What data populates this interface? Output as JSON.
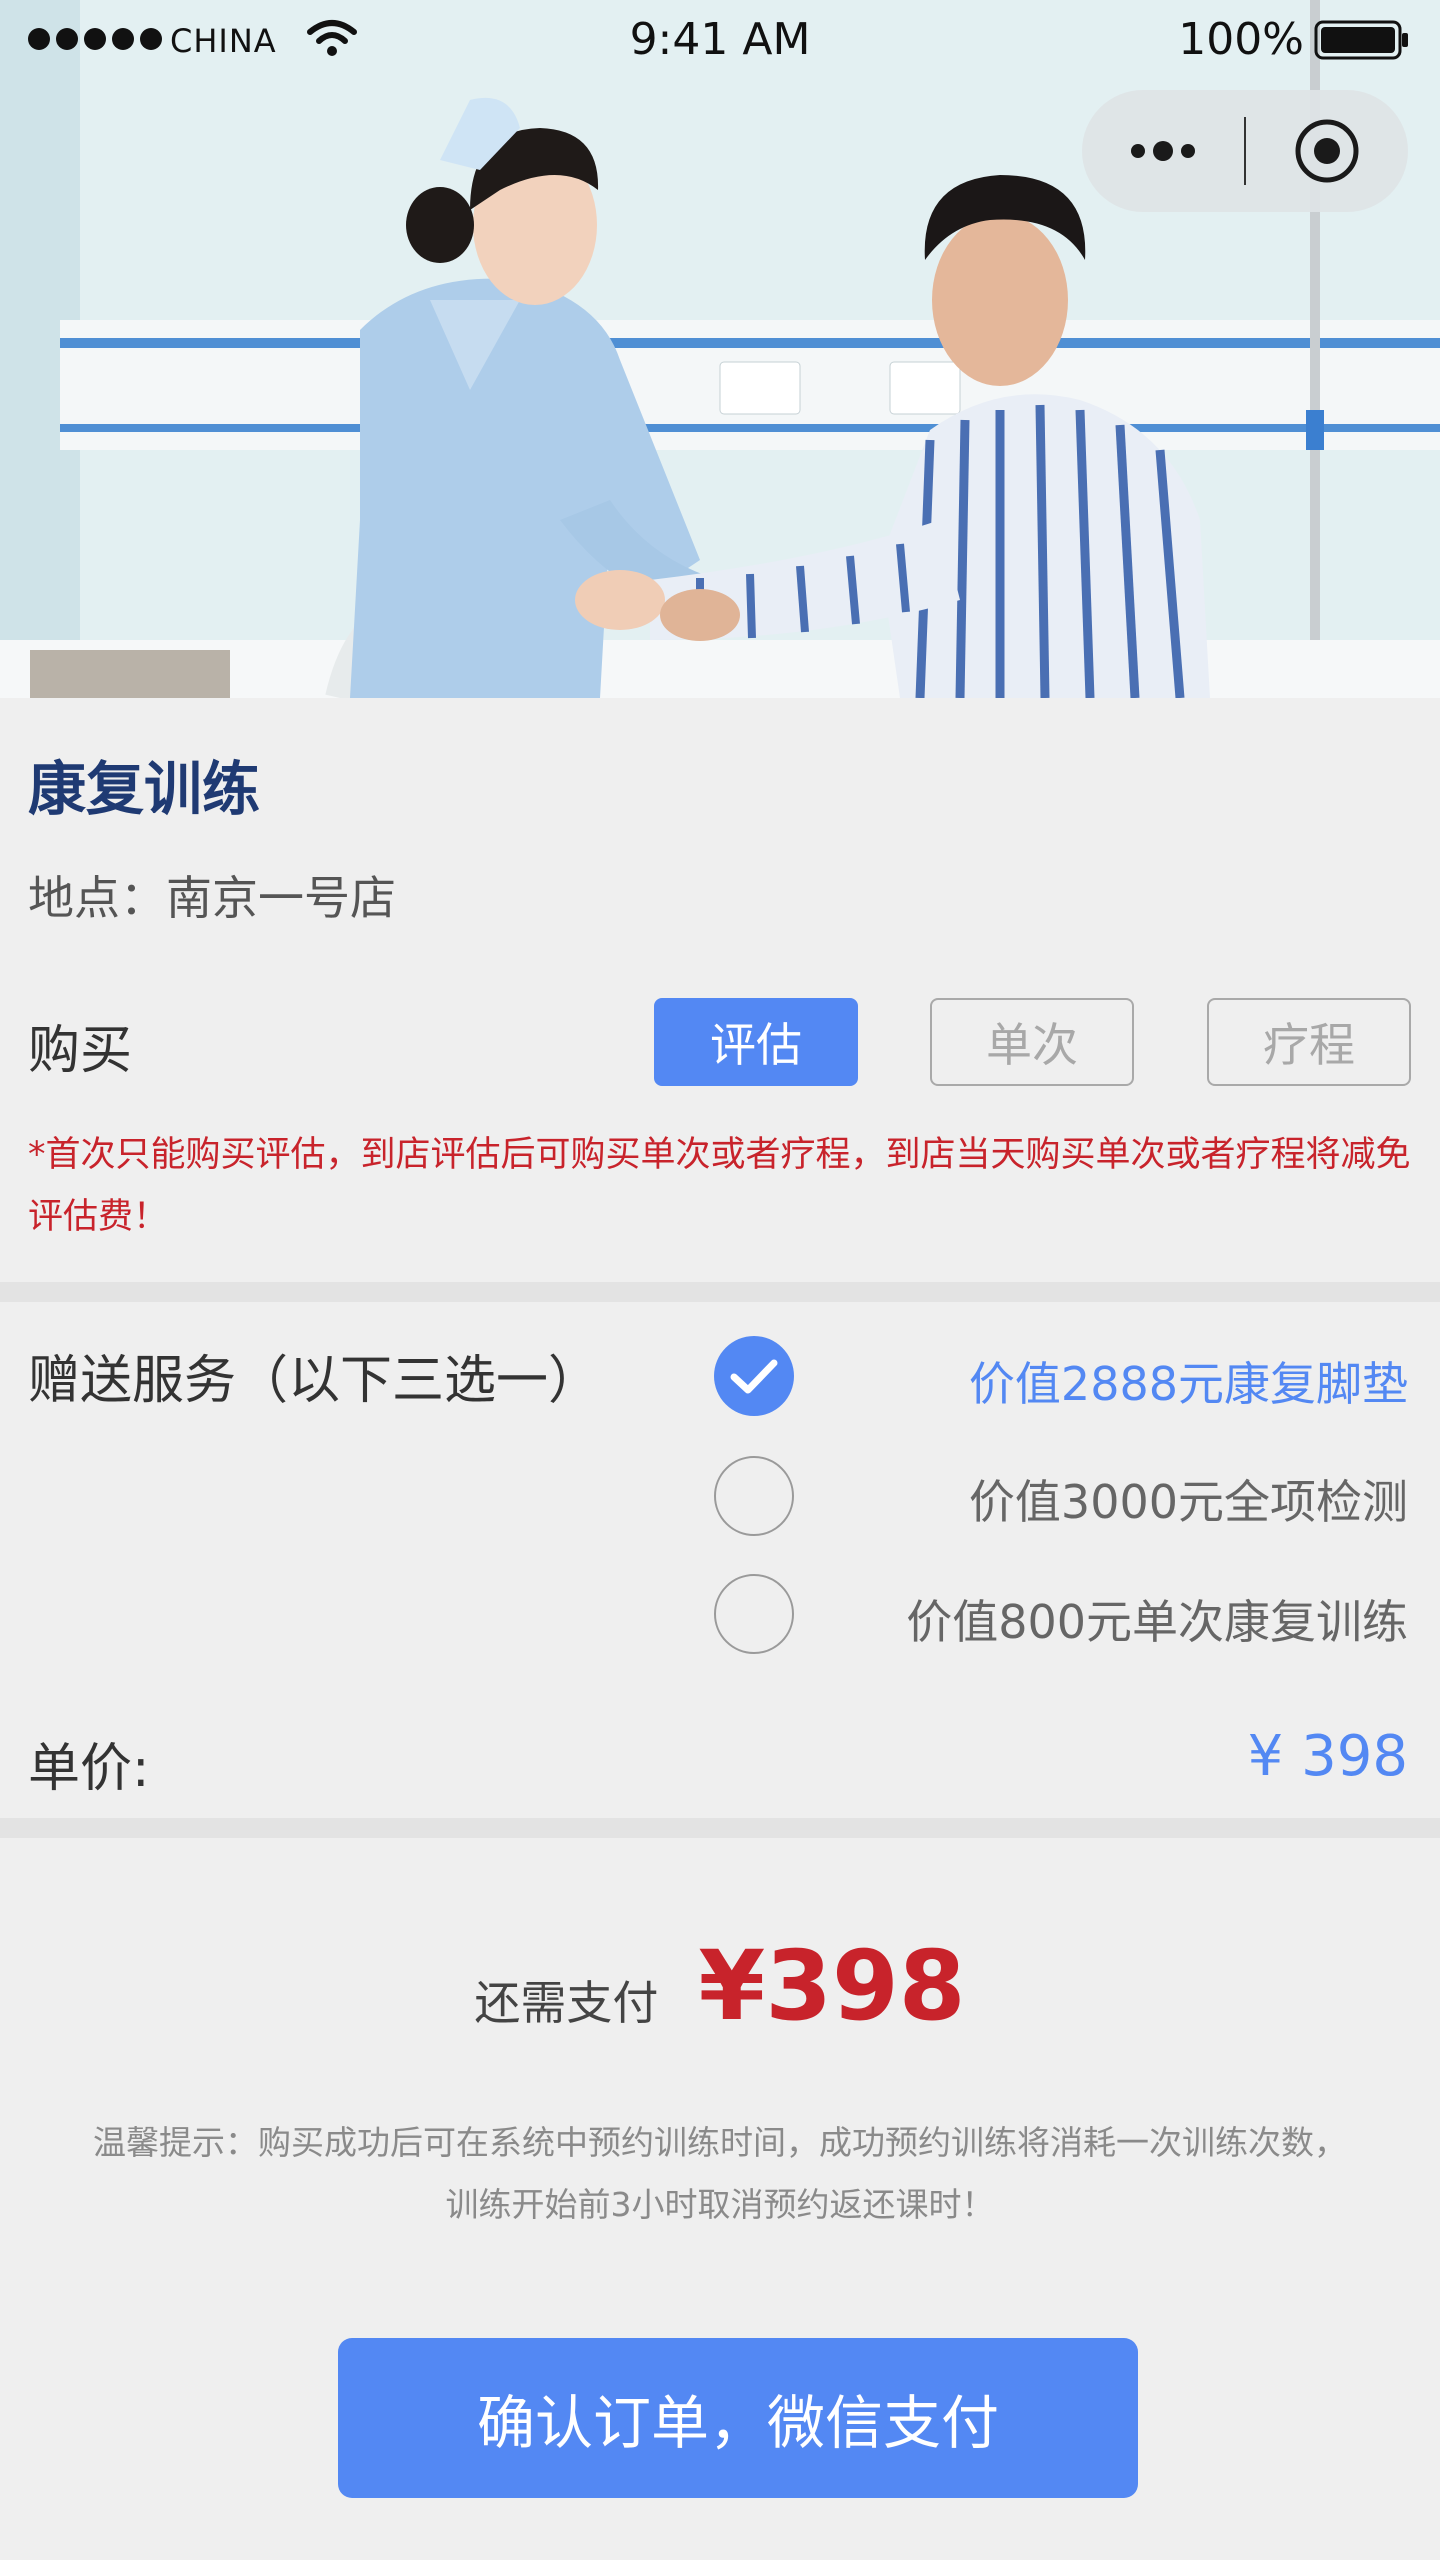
{
  "status_bar": {
    "carrier": "CHINA",
    "time": "9:41 AM",
    "battery": "100%"
  },
  "hero": {
    "image": "nurse-assisting-patient-photo"
  },
  "capsule": {
    "more_icon": "more-dots-icon",
    "close_icon": "target-circle-icon"
  },
  "product": {
    "title": "康复训练",
    "location": "地点：南京一号店"
  },
  "purchase": {
    "label": "购买",
    "options": [
      {
        "label": "评估",
        "selected": true
      },
      {
        "label": "单次",
        "selected": false
      },
      {
        "label": "疗程",
        "selected": false
      }
    ],
    "notice": "*首次只能购买评估，到店评估后可购买单次或者疗程，到店当天购买单次或者疗程将减免评估费！"
  },
  "gift": {
    "label": "赠送服务（以下三选一）",
    "options": [
      {
        "label": "价值2888元康复脚垫",
        "selected": true
      },
      {
        "label": "价值3000元全项检测",
        "selected": false
      },
      {
        "label": "价值800元单次康复训练",
        "selected": false
      }
    ]
  },
  "price": {
    "label": "单价:",
    "value": "¥ 398"
  },
  "payment": {
    "label": "还需支付",
    "amount": "¥398",
    "tip_line1": "温馨提示：购买成功后可在系统中预约训练时间，成功预约训练将消耗一次训练次数，",
    "tip_line2": "训练开始前3小时取消预约返还课时！",
    "button": "确认订单，微信支付"
  },
  "colors": {
    "accent": "#5388f3",
    "alert": "#c8232b",
    "title": "#1f3a73"
  }
}
